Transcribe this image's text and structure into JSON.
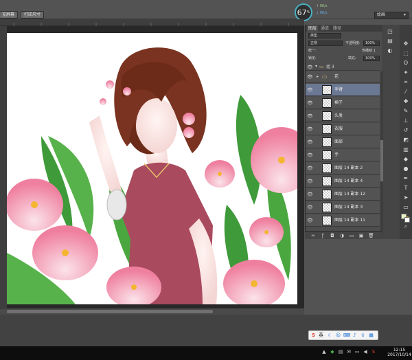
{
  "options_bar": {
    "btn_left": "充屏幕",
    "btn_print": "打印尺寸"
  },
  "performance": {
    "value": "67",
    "unit": "%",
    "up_text": "0K/s",
    "down_text": "0K/s"
  },
  "workspace": {
    "selected": "绘画"
  },
  "layers_panel": {
    "tabs": [
      "图层",
      "通道",
      "路径"
    ],
    "filter_kind": "类型",
    "blend_mode": "正常",
    "opacity_label": "不透明度:",
    "opacity_value": "100%",
    "lock_label": "锁定:",
    "propagate_label": "传播帧 1",
    "unify_label": "统一:",
    "fill_label": "填充:",
    "fill_value": "100%",
    "group_name": "组 3",
    "layers": [
      {
        "name": "花",
        "type": "group"
      },
      {
        "name": "手臂",
        "type": "layer",
        "selected": true
      },
      {
        "name": "裙子",
        "type": "layer"
      },
      {
        "name": "头发",
        "type": "layer"
      },
      {
        "name": "衣服",
        "type": "layer"
      },
      {
        "name": "面部",
        "type": "layer"
      },
      {
        "name": "手",
        "type": "layer"
      },
      {
        "name": "图层 14 副本 2",
        "type": "layer"
      },
      {
        "name": "图层 14 副本 4",
        "type": "layer"
      },
      {
        "name": "图层 14 副本 12",
        "type": "layer"
      },
      {
        "name": "图层 14 副本 3",
        "type": "layer"
      },
      {
        "name": "图层 14 副本 11",
        "type": "layer"
      }
    ]
  },
  "ime": {
    "label": "英"
  },
  "clock": {
    "time": "12:15",
    "date": "2017/10/14"
  },
  "colors": {
    "fg": "#e9f3c8",
    "bg": "#ffffff",
    "selection": "#6b7893"
  }
}
